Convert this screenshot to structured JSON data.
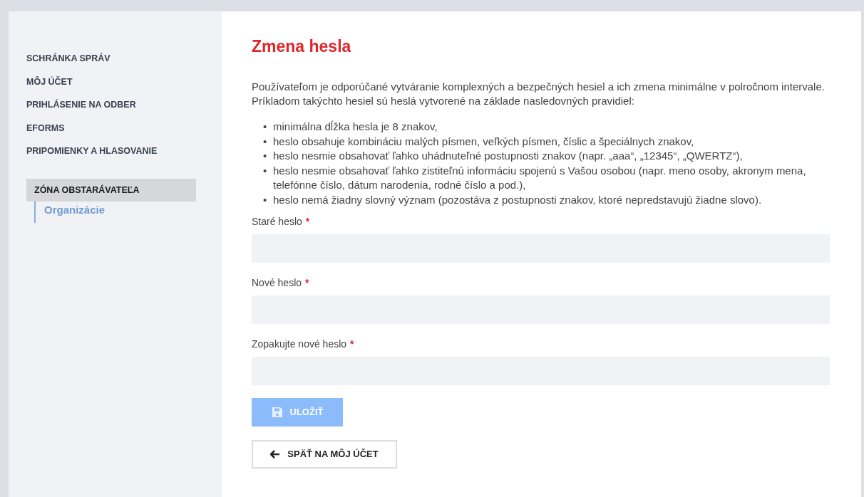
{
  "sidebar": {
    "items": [
      {
        "label": "SCHRÁNKA SPRÁV"
      },
      {
        "label": "MÔJ ÚČET"
      },
      {
        "label": "PRIHLÁSENIE NA ODBER"
      },
      {
        "label": "EFORMS"
      },
      {
        "label": "PRIPOMIENKY A HLASOVANIE"
      }
    ],
    "group": {
      "label": "ZÓNA OBSTARÁVATEĽA",
      "children": [
        {
          "label": "Organizácie",
          "selected": true
        }
      ]
    }
  },
  "page": {
    "title": "Zmena hesla",
    "intro": "Používateľom je odporúčané vytváranie komplexných a bezpečných hesiel a ich zmena minimálne v polročnom intervale. Príkladom takýchto hesiel sú heslá vytvorené na základe nasledovných pravidiel:",
    "bullet": "•",
    "rules": [
      "minimálna dĺžka hesla je 8 znakov,",
      "heslo obsahuje kombináciu malých písmen, veľkých písmen, číslic a špeciálnych znakov,",
      "heslo nesmie obsahovať ľahko uhádnuteľné postupnosti znakov (napr. „aaa“, „12345“, „QWERTZ“),",
      "heslo nesmie obsahovať ľahko zistiteľnú informáciu spojenú s Vašou osobou (napr. meno osoby, akronym mena, telefónne číslo, dátum narodenia, rodné číslo a pod.),",
      "heslo nemá žiadny slovný význam (pozostáva z postupnosti znakov, ktoré nepredstavujú žiadne slovo)."
    ],
    "fields": [
      {
        "label": "Staré heslo",
        "required_mark": "*"
      },
      {
        "label": "Nové heslo",
        "required_mark": "*"
      },
      {
        "label": "Zopakujte nové heslo",
        "required_mark": "*"
      }
    ],
    "save_button": {
      "label": "ULOŽIŤ",
      "disabled": true
    },
    "back_button": {
      "label": "SPÄŤ NA MÔJ ÚČET"
    }
  }
}
